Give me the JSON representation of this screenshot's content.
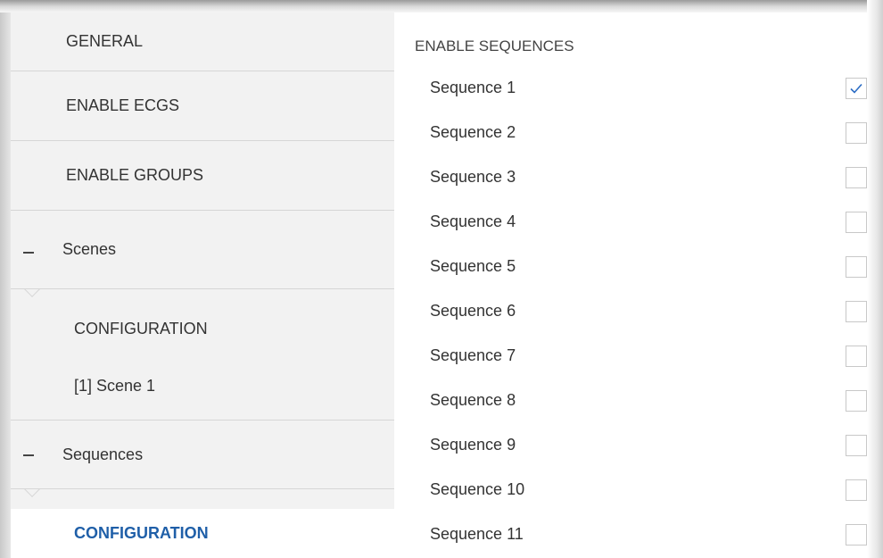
{
  "sidebar": {
    "items": [
      {
        "label": "GENERAL"
      },
      {
        "label": "ENABLE ECGS"
      },
      {
        "label": "ENABLE GROUPS"
      }
    ],
    "scenes": {
      "label": "Scenes",
      "children": [
        {
          "label": "CONFIGURATION"
        },
        {
          "label": "[1] Scene 1"
        }
      ]
    },
    "sequences": {
      "label": "Sequences",
      "children": [
        {
          "label": "CONFIGURATION"
        }
      ]
    }
  },
  "main": {
    "title": "ENABLE SEQUENCES",
    "rows": [
      {
        "label": "Sequence 1",
        "checked": true
      },
      {
        "label": "Sequence 2",
        "checked": false
      },
      {
        "label": "Sequence 3",
        "checked": false
      },
      {
        "label": "Sequence 4",
        "checked": false
      },
      {
        "label": "Sequence 5",
        "checked": false
      },
      {
        "label": "Sequence 6",
        "checked": false
      },
      {
        "label": "Sequence 7",
        "checked": false
      },
      {
        "label": "Sequence 8",
        "checked": false
      },
      {
        "label": "Sequence 9",
        "checked": false
      },
      {
        "label": "Sequence 10",
        "checked": false
      },
      {
        "label": "Sequence 11",
        "checked": false
      }
    ]
  },
  "colors": {
    "active_text": "#1f5fa8",
    "sidebar_bg": "#f2f2f2",
    "check": "#2b6cc4"
  }
}
